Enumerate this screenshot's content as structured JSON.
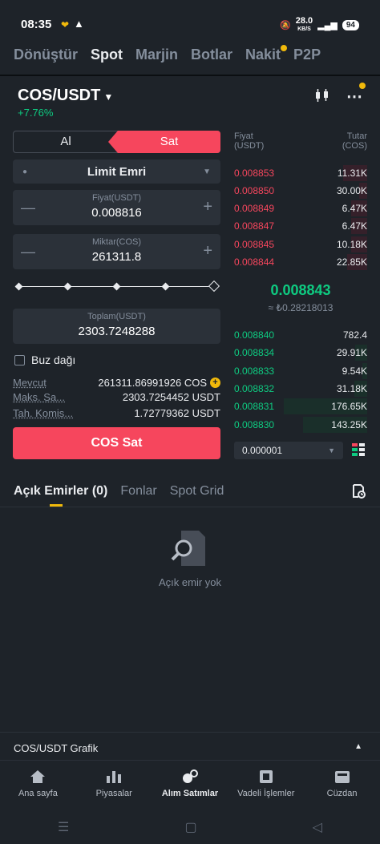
{
  "status_bar": {
    "time": "08:35",
    "speed": "28.0",
    "speed_unit": "KB/S",
    "battery": "94"
  },
  "top_tabs": [
    "Dönüştür",
    "Spot",
    "Marjin",
    "Botlar",
    "Nakit",
    "P2P"
  ],
  "pair": {
    "name": "COS/USDT",
    "change": "+7.76%"
  },
  "trade": {
    "buy_label": "Al",
    "sell_label": "Sat",
    "order_type": "Limit Emri",
    "price_label": "Fiyat(USDT)",
    "price_value": "0.008816",
    "amount_label": "Miktar(COS)",
    "amount_value": "261311.8",
    "total_label": "Toplam(USDT)",
    "total_value": "2303.7248288",
    "iceberg_label": "Buz dağı",
    "available_label": "Mevcut",
    "available_value": "261311.86991926 COS",
    "max_sell_label": "Maks. Sa...",
    "max_sell_value": "2303.7254452 USDT",
    "fee_label": "Tah. Komis...",
    "fee_value": "1.72779362 USDT",
    "submit_label": "COS Sat"
  },
  "orderbook": {
    "price_header": "Fiyat",
    "price_unit": "(USDT)",
    "amount_header": "Tutar",
    "amount_unit": "(COS)",
    "asks": [
      {
        "price": "0.008853",
        "amount": "11.31K"
      },
      {
        "price": "0.008850",
        "amount": "30.00K"
      },
      {
        "price": "0.008849",
        "amount": "6.47K"
      },
      {
        "price": "0.008847",
        "amount": "6.47K"
      },
      {
        "price": "0.008845",
        "amount": "10.18K"
      },
      {
        "price": "0.008844",
        "amount": "22.85K"
      }
    ],
    "last_price": "0.008843",
    "last_price_try": "≈ ₺0.28218013",
    "bids": [
      {
        "price": "0.008840",
        "amount": "782.4"
      },
      {
        "price": "0.008834",
        "amount": "29.91K"
      },
      {
        "price": "0.008833",
        "amount": "9.54K"
      },
      {
        "price": "0.008832",
        "amount": "31.18K"
      },
      {
        "price": "0.008831",
        "amount": "176.65K"
      },
      {
        "price": "0.008830",
        "amount": "143.25K"
      }
    ],
    "precision": "0.000001"
  },
  "orders_tabs": [
    "Açık Emirler (0)",
    "Fonlar",
    "Spot Grid"
  ],
  "empty_text": "Açık emir yok",
  "chart_bar_label": "COS/USDT Grafik",
  "bottom_nav": [
    "Ana sayfa",
    "Piyasalar",
    "Alım Satımlar",
    "Vadeli İşlemler",
    "Cüzdan"
  ],
  "colors": {
    "bg": "#1e2329",
    "sell": "#f6465d",
    "buy": "#0ecb81",
    "accent": "#f0b90b"
  }
}
